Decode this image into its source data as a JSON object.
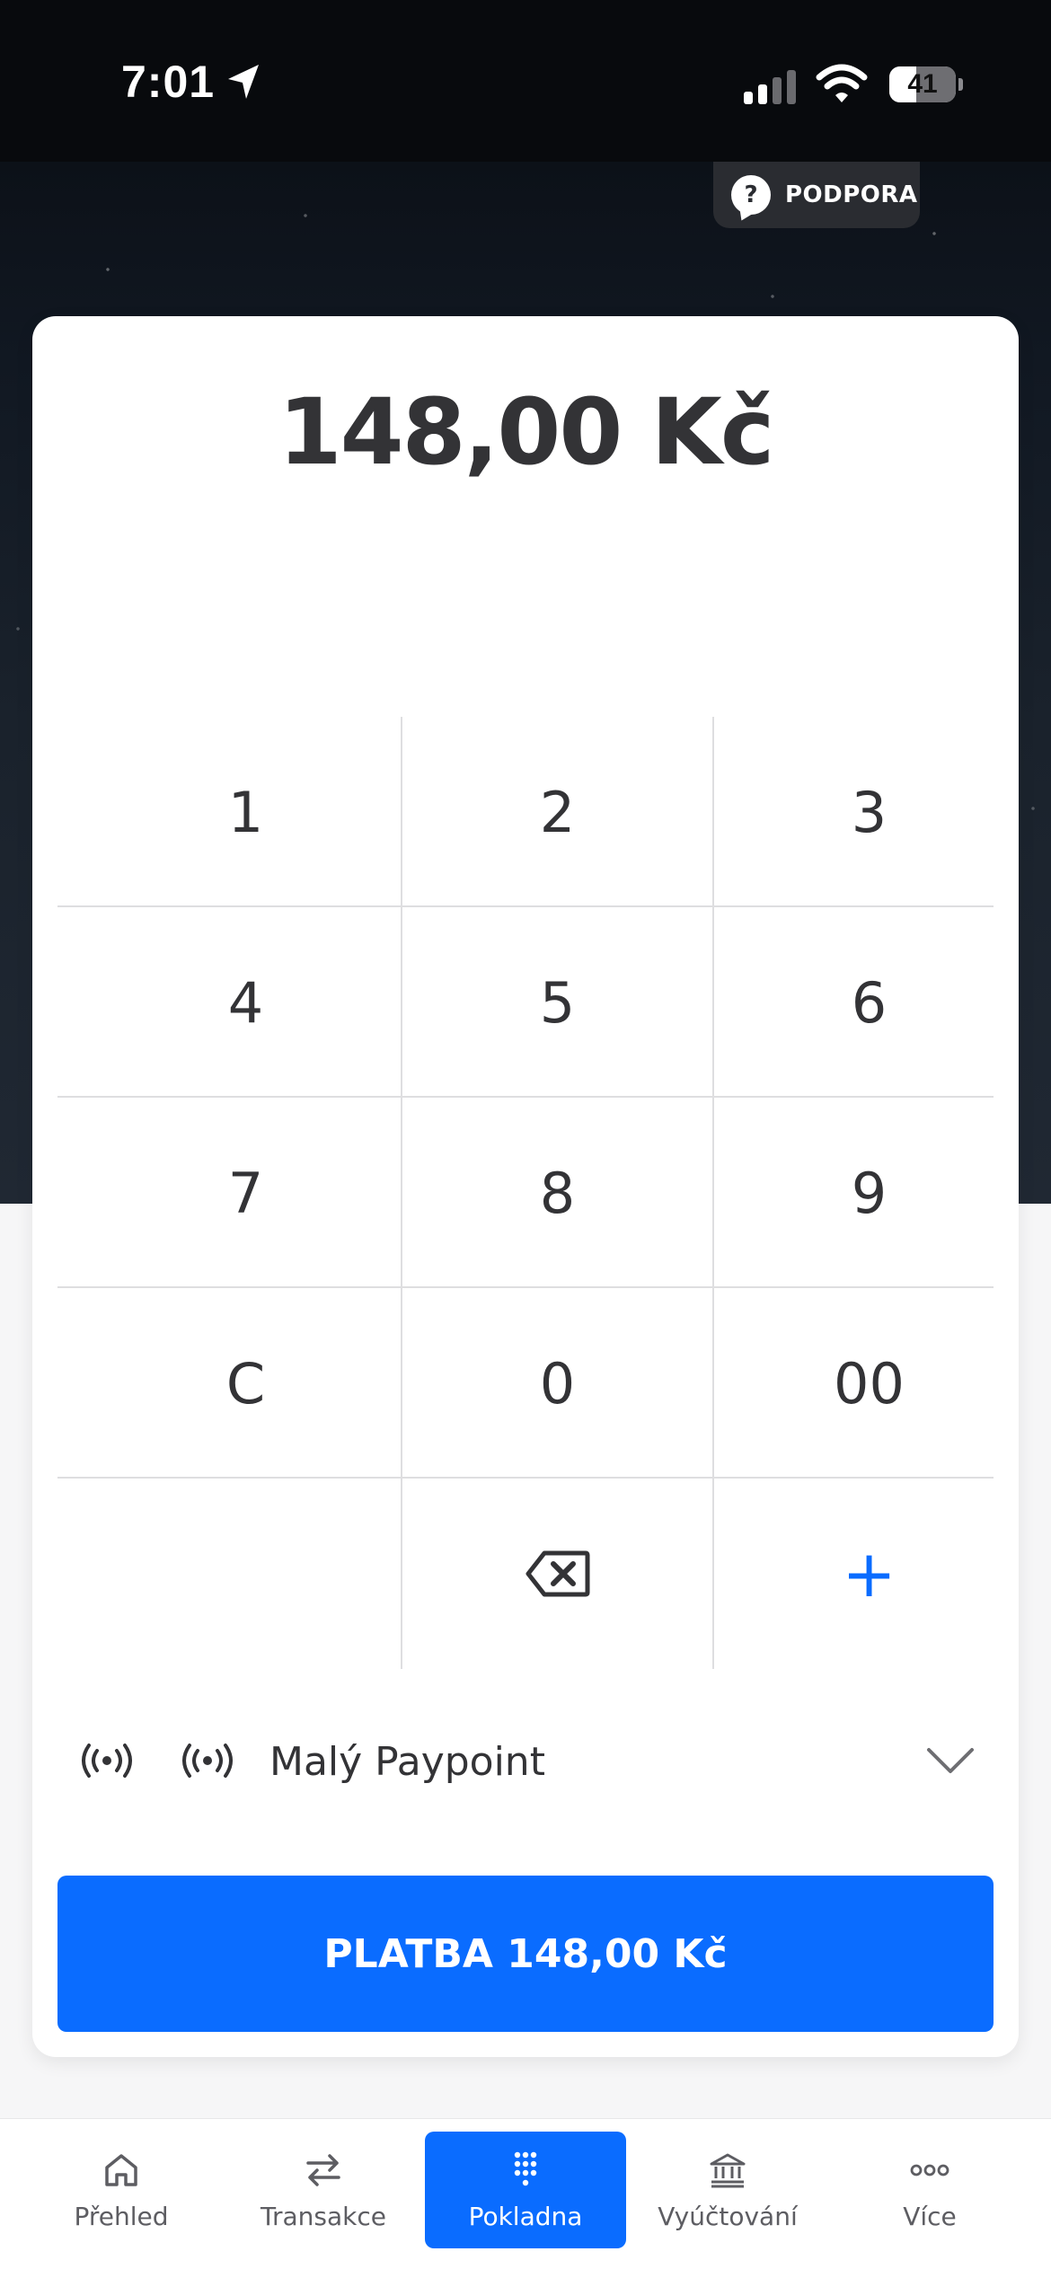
{
  "status_bar": {
    "time": "7:01",
    "battery_level": "41",
    "battery_fraction": 0.41
  },
  "support": {
    "icon": "question-bubble-icon",
    "label": "PODPORA"
  },
  "amount": "148,00 Kč",
  "keypad": {
    "keys": [
      "1",
      "2",
      "3",
      "4",
      "5",
      "6",
      "7",
      "8",
      "9",
      "C",
      "0",
      "00"
    ],
    "backspace_icon": "backspace-icon",
    "plus": "+"
  },
  "device": {
    "name": "Malý Paypoint",
    "icon": "nfc-icon"
  },
  "pay_button": "PLATBA 148,00 Kč",
  "tabs": [
    {
      "label": "Přehled",
      "icon": "home-icon"
    },
    {
      "label": "Transakce",
      "icon": "transfer-arrows-icon"
    },
    {
      "label": "Pokladna",
      "icon": "keypad-icon"
    },
    {
      "label": "Vyúčtování",
      "icon": "bank-icon"
    },
    {
      "label": "Více",
      "icon": "more-icon"
    }
  ],
  "colors": {
    "accent": "#0a6cff",
    "text": "#333336"
  }
}
